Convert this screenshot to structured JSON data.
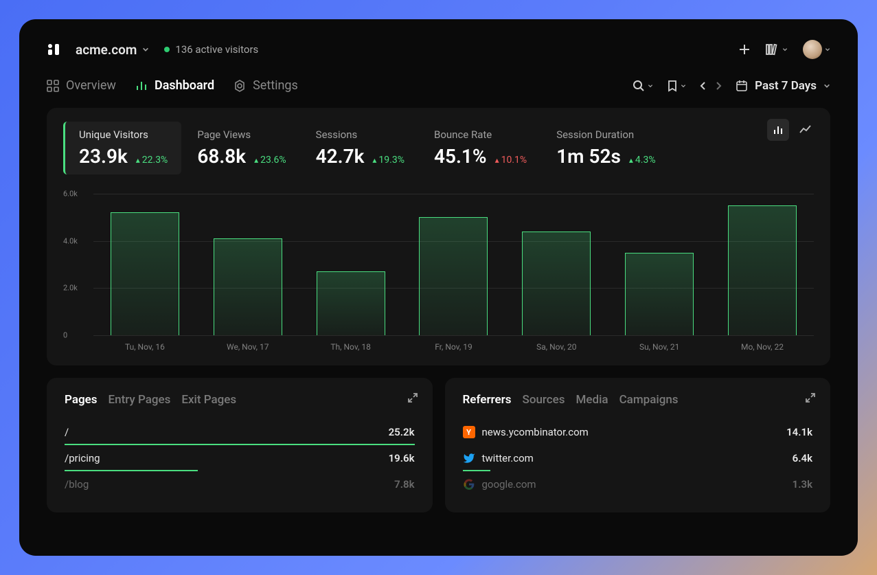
{
  "site": {
    "name": "acme.com",
    "active_visitors_text": "136 active visitors"
  },
  "nav": {
    "tabs": [
      {
        "label": "Overview",
        "icon": "grid-icon"
      },
      {
        "label": "Dashboard",
        "icon": "chart-icon"
      },
      {
        "label": "Settings",
        "icon": "gear-icon"
      }
    ],
    "date_range": "Past 7 Days"
  },
  "metrics": [
    {
      "label": "Unique Visitors",
      "value": "23.9k",
      "delta": "22.3%",
      "direction": "up"
    },
    {
      "label": "Page Views",
      "value": "68.8k",
      "delta": "23.6%",
      "direction": "up"
    },
    {
      "label": "Sessions",
      "value": "42.7k",
      "delta": "19.3%",
      "direction": "up"
    },
    {
      "label": "Bounce Rate",
      "value": "45.1%",
      "delta": "10.1%",
      "direction": "down"
    },
    {
      "label": "Session Duration",
      "value": "1m 52s",
      "delta": "4.3%",
      "direction": "up"
    }
  ],
  "chart_data": {
    "type": "bar",
    "categories": [
      "Tu, Nov, 16",
      "We, Nov, 17",
      "Th, Nov, 18",
      "Fr, Nov, 19",
      "Sa, Nov, 20",
      "Su, Nov, 21",
      "Mo, Nov, 22"
    ],
    "values": [
      5200,
      4100,
      2700,
      5000,
      4400,
      3500,
      5500
    ],
    "ylabel": "",
    "xlabel": "",
    "ylim": [
      0,
      6000
    ],
    "y_ticks": [
      "0",
      "2.0k",
      "4.0k",
      "6.0k"
    ],
    "title": ""
  },
  "pages_panel": {
    "tabs": [
      "Pages",
      "Entry Pages",
      "Exit Pages"
    ],
    "rows": [
      {
        "path": "/",
        "value": "25.2k",
        "pct": 100
      },
      {
        "path": "/pricing",
        "value": "19.6k",
        "pct": 38
      },
      {
        "path": "/blog",
        "value": "7.8k",
        "pct": 0,
        "faded": true
      }
    ]
  },
  "referrers_panel": {
    "tabs": [
      "Referrers",
      "Sources",
      "Media",
      "Campaigns"
    ],
    "rows": [
      {
        "name": "news.ycombinator.com",
        "value": "14.1k",
        "icon": "yc",
        "pct": 0
      },
      {
        "name": "twitter.com",
        "value": "6.4k",
        "icon": "tw",
        "pct": 8
      },
      {
        "name": "google.com",
        "value": "1.3k",
        "icon": "gg",
        "pct": 0,
        "faded": true
      }
    ]
  }
}
